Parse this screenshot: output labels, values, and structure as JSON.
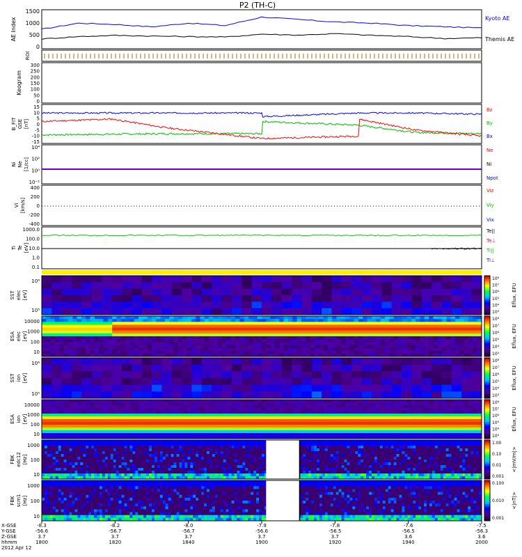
{
  "title": "P2 (TH-C)",
  "panels": {
    "ae": {
      "ylabel": "AE Index",
      "ticks": [
        "1500",
        "1000",
        "500",
        "0"
      ],
      "series": [
        {
          "name": "Kyoto AE",
          "color": "#0000ff"
        },
        {
          "name": "Themis AE",
          "color": "#000000"
        }
      ]
    },
    "roi": {
      "ylabel": "ROI"
    },
    "keogram": {
      "ylabel": "Keogram",
      "ticks": [
        "300",
        "250",
        "200",
        "150",
        "100",
        "50",
        "0"
      ]
    },
    "bfield": {
      "ylabel": [
        "B_FIT",
        "GSE",
        "[nT]"
      ],
      "ticks": [
        "15",
        "10",
        "5",
        "0",
        "-5",
        "-10",
        "-15"
      ],
      "legend": [
        {
          "name": "Bz",
          "color": "#ff0000"
        },
        {
          "name": "By",
          "color": "#00bb00"
        },
        {
          "name": "Bx",
          "color": "#0000ff"
        }
      ]
    },
    "density": {
      "ylabel": [
        "Ni",
        "Ne",
        "[1/cc]"
      ],
      "ticks": [
        "10⁴",
        "10²",
        "10⁰",
        "10⁻²"
      ],
      "legend": [
        {
          "name": "Ne",
          "color": "#ff0000"
        },
        {
          "name": "Ni",
          "color": "#000000"
        },
        {
          "name": "Npot",
          "color": "#0000ff"
        }
      ]
    },
    "velocity": {
      "ylabel": [
        "Vi",
        "[km/s]"
      ],
      "ticks": [
        "400",
        "200",
        "0",
        "-200",
        "-400"
      ],
      "legend": [
        {
          "name": "Viz",
          "color": "#ff0000"
        },
        {
          "name": "Viy",
          "color": "#00bb00"
        },
        {
          "name": "Vix",
          "color": "#0000ff"
        }
      ]
    },
    "temperature": {
      "ylabel": [
        "Ti",
        "Te",
        "[eV]"
      ],
      "ticks": [
        "1000.0",
        "100.0",
        "10.0",
        "1.0",
        "0.1"
      ],
      "legend": [
        {
          "name": "Te||",
          "color": "#000000"
        },
        {
          "name": "Te⊥",
          "color": "#ff0000"
        },
        {
          "name": "Ti||",
          "color": "#00bb00"
        },
        {
          "name": "Ti⊥",
          "color": "#0000ff"
        }
      ]
    },
    "spectra": [
      {
        "ylabel": [
          "SST",
          "elec",
          "[eV]"
        ],
        "ticks": [
          "10⁶",
          "10⁵"
        ],
        "colorbar": "Eflux, EFU",
        "cb_ticks": [
          "10⁸",
          "10⁷",
          "10⁶",
          "10⁵",
          "10⁴",
          "10³"
        ]
      },
      {
        "ylabel": [
          "ESA",
          "elec",
          "[eV]"
        ],
        "ticks": [
          "10000",
          "1000",
          "100",
          "10"
        ],
        "colorbar": "Eflux, EFU",
        "cb_ticks": [
          "10⁸",
          "10⁷",
          "10⁶",
          "10⁵",
          "10⁴",
          "10³"
        ]
      },
      {
        "ylabel": [
          "SST",
          "ion",
          "[eV]"
        ],
        "ticks": [
          "10⁶",
          "10⁵"
        ],
        "colorbar": "Eflux, EFU",
        "cb_ticks": [
          "10⁸",
          "10⁷",
          "10⁶",
          "10⁵",
          "10⁴",
          "10³"
        ]
      },
      {
        "ylabel": [
          "ESA",
          "ion",
          "[eV]"
        ],
        "ticks": [
          "10000",
          "1000",
          "100",
          "10"
        ],
        "colorbar": "Eflux, EFU",
        "cb_ticks": [
          "10⁸",
          "10⁷",
          "10⁶",
          "10⁵",
          "10⁴",
          "10³"
        ]
      },
      {
        "ylabel": [
          "FBK",
          "edc12",
          "[Hz]"
        ],
        "ticks": [
          "1000",
          "100",
          "10"
        ],
        "colorbar": "<|mV/m|>",
        "cb_ticks": [
          "1.00",
          "0.10",
          "0.01",
          "0.001"
        ]
      },
      {
        "ylabel": [
          "FBK",
          "scm1",
          "[Hz]"
        ],
        "ticks": [
          "1000",
          "100",
          "10"
        ],
        "colorbar": "<|nT|>",
        "cb_ticks": [
          "0.100",
          "0.010",
          "0.001"
        ]
      }
    ]
  },
  "axis_rows": {
    "labels": [
      "X-GSE",
      "Y-GSE",
      "Z-GSE",
      "hhmm",
      "2012 Apr 12"
    ],
    "columns": [
      {
        "x": "-8.3",
        "y": "-56.6",
        "z": "3.7",
        "t": "1800"
      },
      {
        "x": "-8.2",
        "y": "-56.7",
        "z": "3.7",
        "t": "1820"
      },
      {
        "x": "-8.0",
        "y": "-56.7",
        "z": "3.7",
        "t": "1840"
      },
      {
        "x": "-7.9",
        "y": "-56.6",
        "z": "3.7",
        "t": "1900"
      },
      {
        "x": "-7.8",
        "y": "-56.5",
        "z": "3.7",
        "t": "1920"
      },
      {
        "x": "-7.6",
        "y": "-56.5",
        "z": "3.6",
        "t": "1940"
      },
      {
        "x": "-7.5",
        "y": "-56.3",
        "z": "3.6",
        "t": "2000"
      }
    ]
  },
  "chart_data": {
    "type": "line",
    "title": "P2 (TH-C)",
    "x": [
      "1800",
      "1810",
      "1820",
      "1830",
      "1840",
      "1850",
      "1900",
      "1910",
      "1920",
      "1930",
      "1940",
      "1950",
      "2000"
    ],
    "xlabel": "hhmm",
    "series": [
      {
        "name": "Kyoto AE",
        "values": [
          800,
          1050,
          1000,
          900,
          1050,
          950,
          1300,
          1200,
          1100,
          1050,
          950,
          900,
          850
        ]
      },
      {
        "name": "Themis AE",
        "values": [
          400,
          500,
          550,
          520,
          500,
          480,
          600,
          560,
          620,
          550,
          500,
          420,
          450
        ]
      }
    ],
    "ylabel": "AE Index",
    "ylim": [
      0,
      1600
    ]
  }
}
